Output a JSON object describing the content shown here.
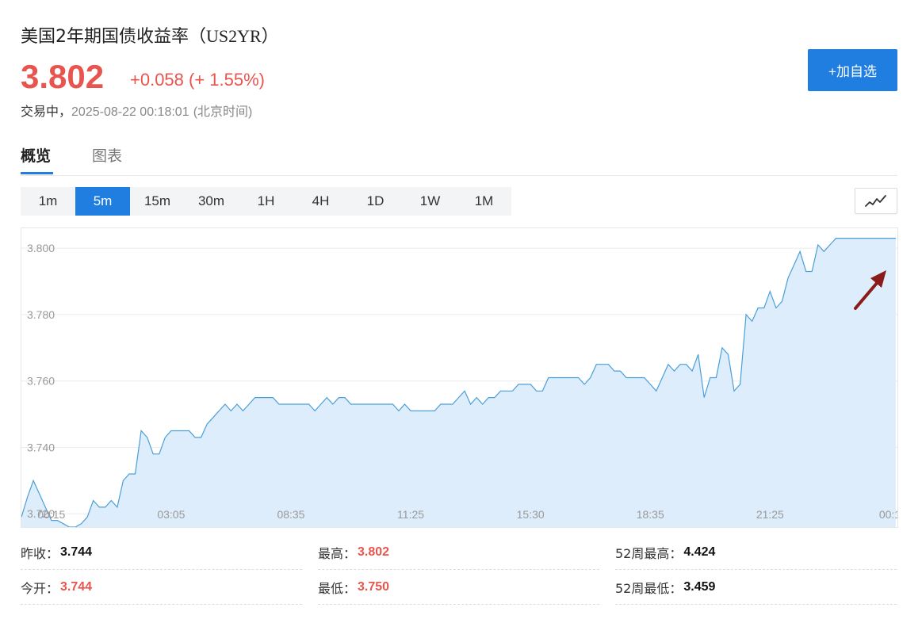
{
  "header": {
    "name": "美国2年期国债收益率",
    "code": "（US2YR）",
    "price": "3.802",
    "change": "+0.058 (+ 1.55%)",
    "status_label": "交易中，",
    "timestamp": "2025-08-22 00:18:01",
    "timezone": "(北京时间)",
    "add_button": "+加自选"
  },
  "colors": {
    "up": "#e8554e",
    "accent": "#1f7ee0",
    "line": "#4a9fd8",
    "area": "#deedfb",
    "arrow": "#8b1a1a"
  },
  "tabs": [
    {
      "label": "概览",
      "active": true
    },
    {
      "label": "图表",
      "active": false
    }
  ],
  "periods": [
    {
      "label": "1m",
      "active": false
    },
    {
      "label": "5m",
      "active": true
    },
    {
      "label": "15m",
      "active": false
    },
    {
      "label": "30m",
      "active": false
    },
    {
      "label": "1H",
      "active": false
    },
    {
      "label": "4H",
      "active": false
    },
    {
      "label": "1D",
      "active": false
    },
    {
      "label": "1W",
      "active": false
    },
    {
      "label": "1M",
      "active": false
    }
  ],
  "chart_type_icon": "line-chart-icon",
  "chart_data": {
    "type": "area",
    "ylim": [
      3.716,
      3.806
    ],
    "yticks": [
      "3.800",
      "3.780",
      "3.760",
      "3.740",
      "3.720"
    ],
    "ytick_values": [
      3.8,
      3.78,
      3.76,
      3.74,
      3.72
    ],
    "xticks": [
      "00:15",
      "03:05",
      "08:35",
      "11:25",
      "15:30",
      "18:35",
      "21:25",
      "00:1"
    ],
    "xtick_index": [
      5,
      25,
      45,
      65,
      85,
      105,
      125,
      145
    ],
    "x_points": 147,
    "series": [
      {
        "values": [
          3.719,
          3.725,
          3.73,
          3.726,
          3.722,
          3.718,
          3.718,
          3.717,
          3.716,
          3.716,
          3.717,
          3.719,
          3.724,
          3.722,
          3.722,
          3.724,
          3.722,
          3.73,
          3.732,
          3.732,
          3.745,
          3.743,
          3.738,
          3.738,
          3.743,
          3.745,
          3.745,
          3.745,
          3.745,
          3.743,
          3.743,
          3.747,
          3.749,
          3.751,
          3.753,
          3.751,
          3.753,
          3.751,
          3.753,
          3.755,
          3.755,
          3.755,
          3.755,
          3.753,
          3.753,
          3.753,
          3.753,
          3.753,
          3.753,
          3.751,
          3.753,
          3.755,
          3.753,
          3.755,
          3.755,
          3.753,
          3.753,
          3.753,
          3.753,
          3.753,
          3.753,
          3.753,
          3.753,
          3.751,
          3.753,
          3.751,
          3.751,
          3.751,
          3.751,
          3.751,
          3.753,
          3.753,
          3.753,
          3.755,
          3.757,
          3.753,
          3.755,
          3.753,
          3.755,
          3.755,
          3.757,
          3.757,
          3.757,
          3.759,
          3.759,
          3.759,
          3.757,
          3.757,
          3.761,
          3.761,
          3.761,
          3.761,
          3.761,
          3.761,
          3.759,
          3.761,
          3.765,
          3.765,
          3.765,
          3.763,
          3.763,
          3.761,
          3.761,
          3.761,
          3.761,
          3.759,
          3.757,
          3.761,
          3.765,
          3.763,
          3.765,
          3.765,
          3.763,
          3.768,
          3.755,
          3.761,
          3.761,
          3.77,
          3.768,
          3.757,
          3.759,
          3.78,
          3.778,
          3.782,
          3.782,
          3.787,
          3.782,
          3.784,
          3.791,
          3.795,
          3.799,
          3.793,
          3.793,
          3.801,
          3.799,
          3.801,
          3.803,
          3.803,
          3.803,
          3.803,
          3.803,
          3.803,
          3.803,
          3.803,
          3.803,
          3.803,
          3.803
        ]
      }
    ],
    "grid": true
  },
  "stats": [
    {
      "label": "昨收：",
      "value": "3.744",
      "color": "black"
    },
    {
      "label": "最高：",
      "value": "3.802",
      "color": "red"
    },
    {
      "label": "52周最高：",
      "value": "4.424",
      "color": "black"
    },
    {
      "label": "今开：",
      "value": "3.744",
      "color": "red"
    },
    {
      "label": "最低：",
      "value": "3.750",
      "color": "red"
    },
    {
      "label": "52周最低：",
      "value": "3.459",
      "color": "black"
    }
  ]
}
